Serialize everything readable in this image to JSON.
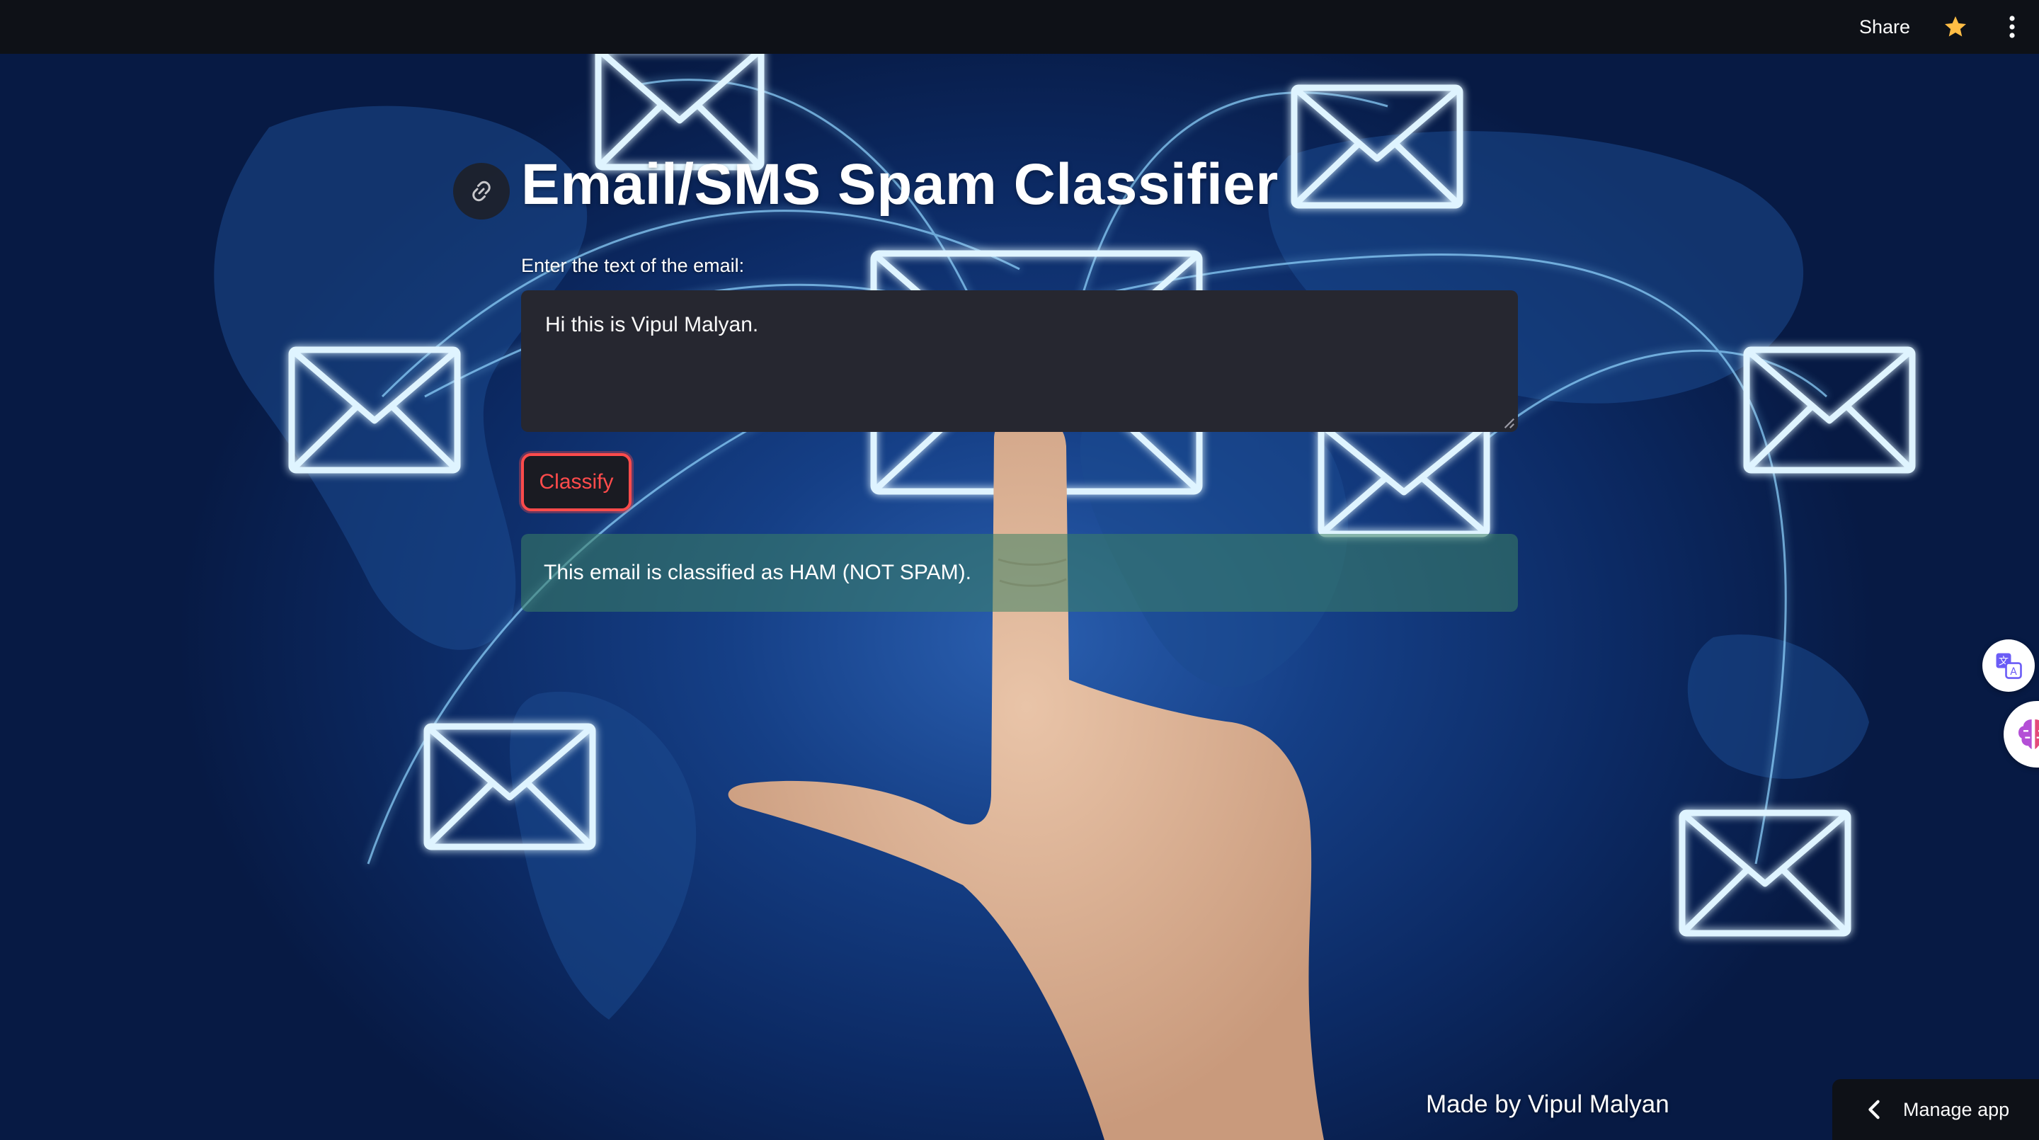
{
  "topbar": {
    "share_label": "Share",
    "star_icon": "star-icon",
    "menu_icon": "kebab-menu-icon"
  },
  "main": {
    "title": "Email/SMS Spam Classifier",
    "anchor_icon": "link-icon",
    "input_label": "Enter the text of the email:",
    "input_value": "Hi this is Vipul Malyan.",
    "classify_label": "Classify",
    "result_text": "This email is classified as HAM (NOT SPAM)."
  },
  "footer": {
    "credit": "Made by Vipul Malyan"
  },
  "manage_app": {
    "label": "Manage app",
    "icon": "chevron-left-icon"
  },
  "side_widgets": {
    "translate_icon": "translate-icon",
    "ai_icon": "brain-icon"
  },
  "colors": {
    "topbar_bg": "#0e1117",
    "accent": "#ff4b4b",
    "input_bg": "#262730",
    "success_bg": "#3c8264",
    "background_blue": "#153f86",
    "glow": "#8fd4ff"
  }
}
